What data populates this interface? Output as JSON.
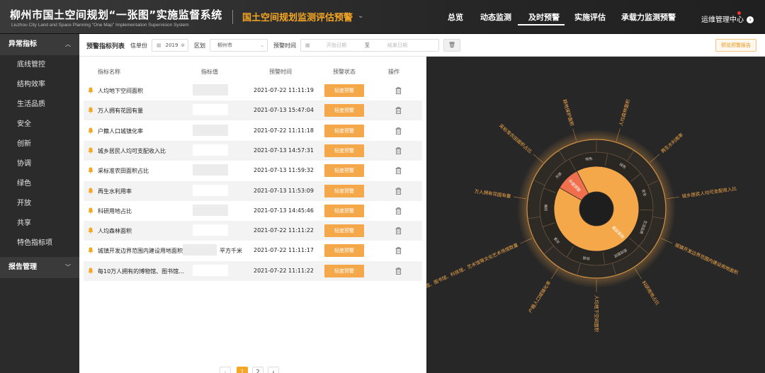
{
  "header": {
    "title": "柳州市国土空间规划“一张图”实施监督系统",
    "subtitle": "Liuzhou City Land and Space Planning \"One Map\" Implementation Supervision System",
    "module": "国土空间规划监测评估预警",
    "nav": [
      "总览",
      "动态监测",
      "及时预警",
      "实施评估",
      "承载力监测预警"
    ],
    "active_nav": "及时预警",
    "user": "运维管理中心"
  },
  "sidebar": {
    "group1": "异常指标",
    "items": [
      "底线管控",
      "结构效率",
      "生活品质",
      "安全",
      "创新",
      "协调",
      "绿色",
      "开放",
      "共享",
      "特色指标项"
    ],
    "group2": "报告管理"
  },
  "filters": {
    "list_label": "预警指标列表",
    "year_label": "信单份",
    "year_value": "2019",
    "district_label": "区划",
    "district_value": "柳州市",
    "time_label": "预警时间",
    "start_ph": "开始日期",
    "to": "至",
    "end_ph": "结束日期",
    "generate": "预览预警报告"
  },
  "table": {
    "headers": [
      "指标名称",
      "指标值",
      "预警时间",
      "预警状态",
      "操作"
    ],
    "rows": [
      {
        "name": "人均地下空间面积",
        "time": "2021-07-22 11:11:19",
        "status": "轻度预警"
      },
      {
        "name": "万人拥有花园有量",
        "time": "2021-07-13 15:47:04",
        "status": "轻度预警"
      },
      {
        "name": "户籍人口城镇化率",
        "time": "2021-07-22 11:11:18",
        "status": "轻度预警"
      },
      {
        "name": "城乡居民人均可支配收入比",
        "time": "2021-07-13 14:57:31",
        "status": "轻度预警"
      },
      {
        "name": "采标准农田面积占比",
        "time": "2021-07-13 11:59:32",
        "status": "轻度预警"
      },
      {
        "name": "再生水利用率",
        "time": "2021-07-13 11:53:09",
        "status": "轻度预警"
      },
      {
        "name": "科研用地占比",
        "time": "2021-07-13 14:45:46",
        "status": "轻度预警"
      },
      {
        "name": "人均森林面积",
        "time": "2021-07-22 11:11:22",
        "status": "轻度预警"
      },
      {
        "name": "城镇开发边界范围内建设用地面积",
        "unit": "平方千米",
        "time": "2021-07-22 11:11:17",
        "status": "轻度预警"
      },
      {
        "name": "每10万人拥有的博物馆、图书馆...",
        "time": "2021-07-22 11:11:22",
        "status": "轻度预警"
      }
    ]
  },
  "pagination": {
    "pages": [
      "1",
      "2"
    ],
    "current": "1",
    "prev": "‹",
    "next": "›"
  },
  "chart_data": {
    "type": "sunburst",
    "inner": [
      {
        "name": "轻度预警",
        "value": 10
      },
      {
        "name": "中度预警",
        "value": 1
      }
    ],
    "middle": [
      "绿色",
      "安全",
      "生活品质",
      "底线管控",
      "协调",
      "共享",
      "创新",
      "开放",
      "特色"
    ],
    "outer": [
      "人均森林面积",
      "再生水利用率",
      "城乡居民人均可支配收入比",
      "城镇开发边界范围内建设用地面积",
      "科研用地占比",
      "人均地下空间面积",
      "户籍人口城镇化率",
      "每10万人拥有博物馆、图书馆、科技馆、艺术馆等文化艺术场馆数量",
      "万人拥有花园有量",
      "采标准农田面积占比",
      "耕地保护面积"
    ],
    "colors": {
      "inner_main": "#f5a84a",
      "inner_alert": "#f0704e",
      "ring": "#3a2a1e",
      "label": "#f5a84a"
    }
  }
}
